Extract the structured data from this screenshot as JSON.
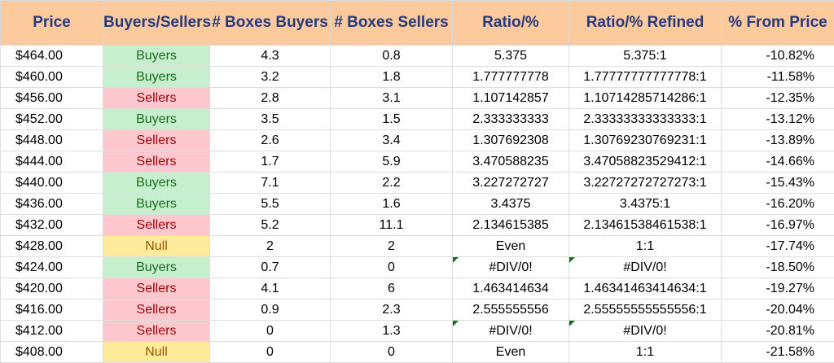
{
  "sheet": {
    "headers": [
      "Price",
      "Buyers/Sellers",
      "# Boxes Buyers",
      "# Boxes Sellers",
      "Ratio/%",
      "Ratio/% Refined",
      "% From Price"
    ],
    "status_colors": {
      "Buyers": {
        "bg": "#c6efce",
        "fg": "#1a6b1a"
      },
      "Sellers": {
        "bg": "#ffc7ce",
        "fg": "#9c0006"
      },
      "Null": {
        "bg": "#ffeb9c",
        "fg": "#9c5700"
      }
    },
    "rows": [
      {
        "price": "$464.00",
        "side": "Buyers",
        "buyers": "4.3",
        "sellers": "0.8",
        "ratio": "5.375",
        "refined": "5.375:1",
        "pct": "-10.82%"
      },
      {
        "price": "$460.00",
        "side": "Buyers",
        "buyers": "3.2",
        "sellers": "1.8",
        "ratio": "1.777777778",
        "refined": "1.77777777777778:1",
        "pct": "-11.58%"
      },
      {
        "price": "$456.00",
        "side": "Sellers",
        "buyers": "2.8",
        "sellers": "3.1",
        "ratio": "1.107142857",
        "refined": "1.10714285714286:1",
        "pct": "-12.35%"
      },
      {
        "price": "$452.00",
        "side": "Buyers",
        "buyers": "3.5",
        "sellers": "1.5",
        "ratio": "2.333333333",
        "refined": "2.33333333333333:1",
        "pct": "-13.12%"
      },
      {
        "price": "$448.00",
        "side": "Sellers",
        "buyers": "2.6",
        "sellers": "3.4",
        "ratio": "1.307692308",
        "refined": "1.30769230769231:1",
        "pct": "-13.89%"
      },
      {
        "price": "$444.00",
        "side": "Sellers",
        "buyers": "1.7",
        "sellers": "5.9",
        "ratio": "3.470588235",
        "refined": "3.47058823529412:1",
        "pct": "-14.66%"
      },
      {
        "price": "$440.00",
        "side": "Buyers",
        "buyers": "7.1",
        "sellers": "2.2",
        "ratio": "3.227272727",
        "refined": "3.22727272727273:1",
        "pct": "-15.43%"
      },
      {
        "price": "$436.00",
        "side": "Buyers",
        "buyers": "5.5",
        "sellers": "1.6",
        "ratio": "3.4375",
        "refined": "3.4375:1",
        "pct": "-16.20%"
      },
      {
        "price": "$432.00",
        "side": "Sellers",
        "buyers": "5.2",
        "sellers": "11.1",
        "ratio": "2.134615385",
        "refined": "2.13461538461538:1",
        "pct": "-16.97%"
      },
      {
        "price": "$428.00",
        "side": "Null",
        "buyers": "2",
        "sellers": "2",
        "ratio": "Even",
        "refined": "1:1",
        "pct": "-17.74%"
      },
      {
        "price": "$424.00",
        "side": "Buyers",
        "buyers": "0.7",
        "sellers": "0",
        "ratio": "#DIV/0!",
        "refined": "#DIV/0!",
        "pct": "-18.50%",
        "error_flag": true
      },
      {
        "price": "$420.00",
        "side": "Sellers",
        "buyers": "4.1",
        "sellers": "6",
        "ratio": "1.463414634",
        "refined": "1.46341463414634:1",
        "pct": "-19.27%"
      },
      {
        "price": "$416.00",
        "side": "Sellers",
        "buyers": "0.9",
        "sellers": "2.3",
        "ratio": "2.555555556",
        "refined": "2.55555555555556:1",
        "pct": "-20.04%"
      },
      {
        "price": "$412.00",
        "side": "Sellers",
        "buyers": "0",
        "sellers": "1.3",
        "ratio": "#DIV/0!",
        "refined": "#DIV/0!",
        "pct": "-20.81%",
        "error_flag": true
      },
      {
        "price": "$408.00",
        "side": "Null",
        "buyers": "0",
        "sellers": "0",
        "ratio": "Even",
        "refined": "1:1",
        "pct": "-21.58%"
      }
    ]
  }
}
